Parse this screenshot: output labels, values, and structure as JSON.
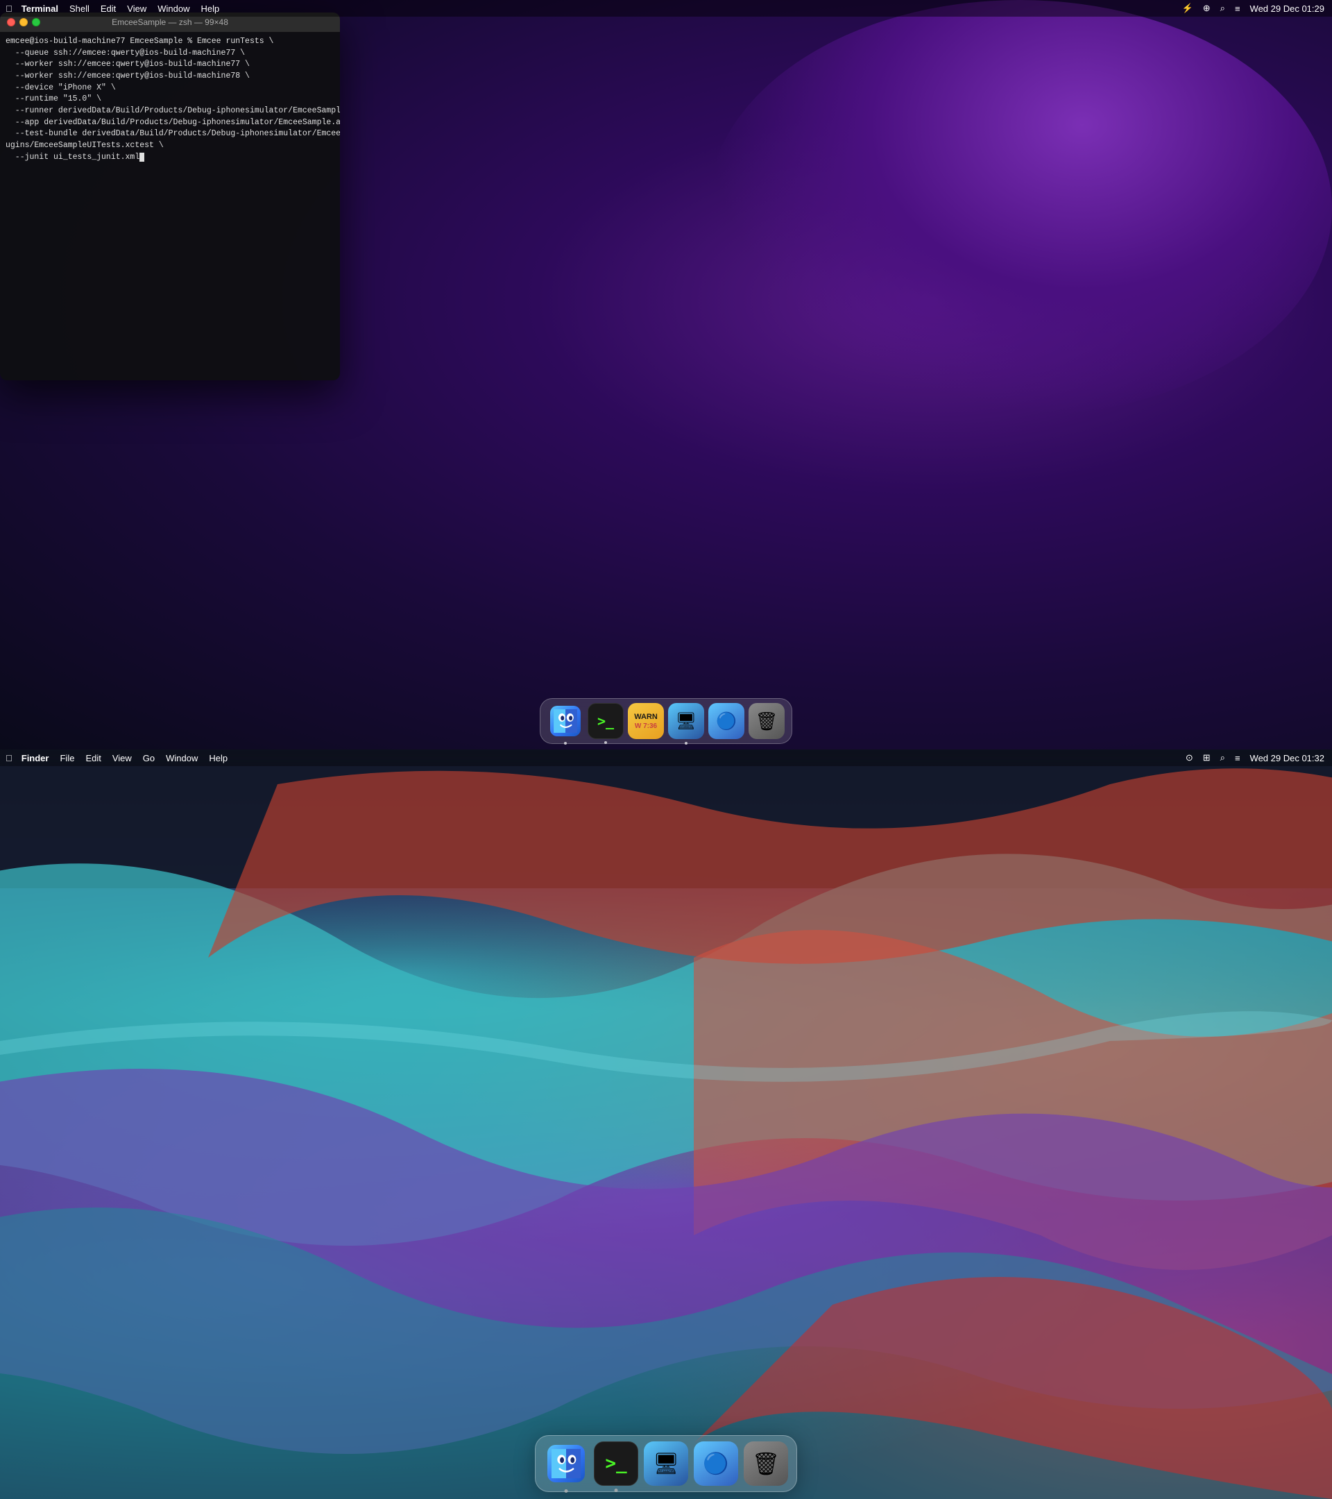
{
  "top_desktop": {
    "menubar": {
      "apple": "⌘",
      "items": [
        "Terminal",
        "Shell",
        "Edit",
        "View",
        "Window",
        "Help"
      ],
      "active_app": "Terminal",
      "right": {
        "icons": [
          "battery",
          "wifi",
          "search",
          "notification",
          "date"
        ],
        "datetime": "Wed 29 Dec 01:29"
      }
    },
    "terminal_window": {
      "title": "EmceeSample — zsh — 99×48",
      "content_lines": [
        "emcee@ios-build-machine77 EmceeSample % Emcee runTests \\",
        "  --queue ssh://emcee:qwerty@ios-build-machine77 \\",
        "  --worker ssh://emcee:qwerty@ios-build-machine77 \\",
        "  --worker ssh://emcee:qwerty@ios-build-machine78 \\",
        "  --device \"iPhone X\" \\",
        "  --runtime \"15.0\" \\",
        "  --runner derivedData/Build/Products/Debug-iphonesimulator/EmceeSampleUITests-Runner.app \\",
        "  --app derivedData/Build/Products/Debug-iphonesimulator/EmceeSample.app \\",
        "  --test-bundle derivedData/Build/Products/Debug-iphonesimulator/EmceeSampleUITests-Runner.app/Pl",
        "ugins/EmceeSampleUITests.xctest \\",
        "  --junit ui_tests_junit.xml"
      ]
    },
    "dock": {
      "items": [
        {
          "name": "Finder",
          "type": "finder",
          "has_dot": true
        },
        {
          "name": "Terminal",
          "type": "terminal",
          "has_dot": true
        },
        {
          "name": "Console",
          "type": "console",
          "has_dot": false
        },
        {
          "name": "Screens",
          "type": "screens",
          "has_dot": true
        },
        {
          "name": "Privacy Cleaner",
          "type": "privacy",
          "has_dot": false
        },
        {
          "name": "Trash",
          "type": "trash",
          "has_dot": false
        }
      ]
    }
  },
  "bottom_desktop": {
    "menubar": {
      "apple": "⌘",
      "items": [
        "Finder",
        "File",
        "Edit",
        "View",
        "Go",
        "Window",
        "Help"
      ],
      "active_app": "Finder",
      "right": {
        "datetime": "Wed 29 Dec 01:32"
      }
    },
    "dock": {
      "items": [
        {
          "name": "Finder",
          "type": "finder",
          "has_dot": true
        },
        {
          "name": "Terminal",
          "type": "terminal",
          "has_dot": true
        },
        {
          "name": "Screens",
          "type": "screens",
          "has_dot": false
        },
        {
          "name": "Privacy Cleaner",
          "type": "privacy",
          "has_dot": false
        },
        {
          "name": "Trash",
          "type": "trash",
          "has_dot": false
        }
      ]
    }
  }
}
